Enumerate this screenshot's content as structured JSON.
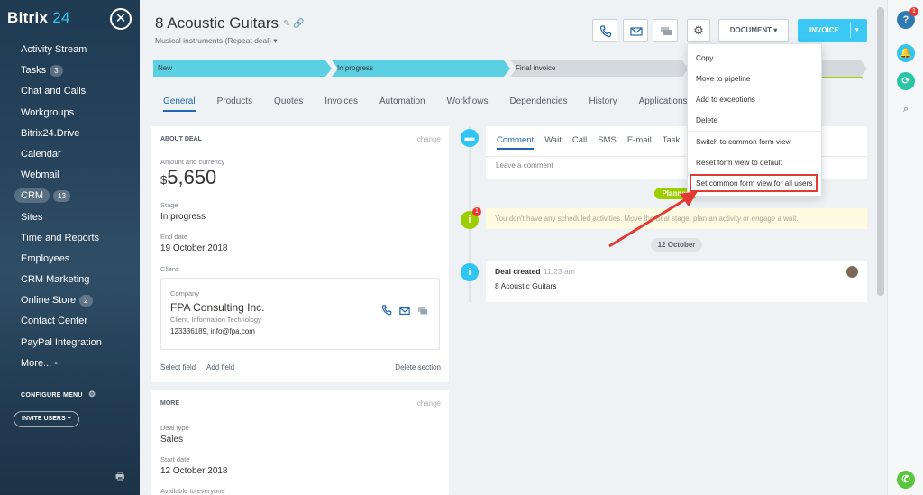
{
  "sidebar": {
    "logo_text": "Bitrix",
    "logo_num": "24",
    "items": [
      {
        "label": "Activity Stream",
        "badge": ""
      },
      {
        "label": "Tasks",
        "badge": "3"
      },
      {
        "label": "Chat and Calls",
        "badge": ""
      },
      {
        "label": "Workgroups",
        "badge": ""
      },
      {
        "label": "Bitrix24.Drive",
        "badge": ""
      },
      {
        "label": "Calendar",
        "badge": ""
      },
      {
        "label": "Webmail",
        "badge": ""
      },
      {
        "label": "CRM",
        "badge": "13"
      },
      {
        "label": "Sites",
        "badge": ""
      },
      {
        "label": "Time and Reports",
        "badge": ""
      },
      {
        "label": "Employees",
        "badge": ""
      },
      {
        "label": "CRM Marketing",
        "badge": ""
      },
      {
        "label": "Online Store",
        "badge": "2"
      },
      {
        "label": "Contact Center",
        "badge": ""
      },
      {
        "label": "PayPal Integration",
        "badge": ""
      },
      {
        "label": "More... -",
        "badge": ""
      }
    ],
    "configure_label": "CONFIGURE MENU",
    "invite_label": "INVITE USERS  +"
  },
  "header": {
    "title": "8 Acoustic Guitars",
    "subtitle": "Musical instruments (Repeat deal) ▾",
    "document_label": "DOCUMENT  ▾",
    "invoice_label": "INVOICE",
    "invoice_arrow": "▾"
  },
  "stages": [
    "New",
    "In progress",
    "Final invoice",
    ""
  ],
  "tabs": [
    "General",
    "Products",
    "Quotes",
    "Invoices",
    "Automation",
    "Workflows",
    "Dependencies",
    "History",
    "Applications"
  ],
  "about": {
    "title": "ABOUT DEAL",
    "change": "change",
    "amount_label": "Amount and currency",
    "currency": "$",
    "amount": "5,650",
    "stage_label": "Stage",
    "stage_value": "In progress",
    "end_label": "End date",
    "end_value": "19 October 2018",
    "client_label": "Client",
    "company_label": "Company",
    "company_name": "FPA Consulting Inc.",
    "company_type": "Client, Information Technology",
    "company_contact": "123336189, info@fpa.com",
    "select_field": "Select field",
    "add_field": "Add field",
    "delete_section": "Delete section"
  },
  "more": {
    "title": "MORE",
    "change": "change",
    "deal_type_label": "Deal type",
    "deal_type_value": "Sales",
    "start_label": "Start date",
    "start_value": "12 October 2018",
    "available_label": "Available to everyone"
  },
  "activity": {
    "tabs": [
      "Comment",
      "Wait",
      "Call",
      "SMS",
      "E-mail",
      "Task"
    ],
    "placeholder": "Leave a comment",
    "planned": "Planned",
    "notice_badge": "1",
    "notice": "You don't have any scheduled activities. Move the deal stage, plan an activity or engage a wait.",
    "date_pill": "12 October",
    "deal_created": "Deal created",
    "deal_time": "11:23 am",
    "deal_name": "8 Acoustic Guitars"
  },
  "dropdown": {
    "items": [
      "Copy",
      "Move to pipeline",
      "Add to exceptions",
      "Delete",
      "Switch to common form view",
      "Reset form view to default",
      "Set common form view for all users"
    ]
  },
  "rail": {
    "help_badge": "1"
  },
  "colors": {
    "accent": "#2067b0",
    "invoice": "#3bc8f5",
    "stage_active": "#5bd0e3",
    "stage_inactive": "#d4d9de",
    "highlight": "#e53935"
  }
}
